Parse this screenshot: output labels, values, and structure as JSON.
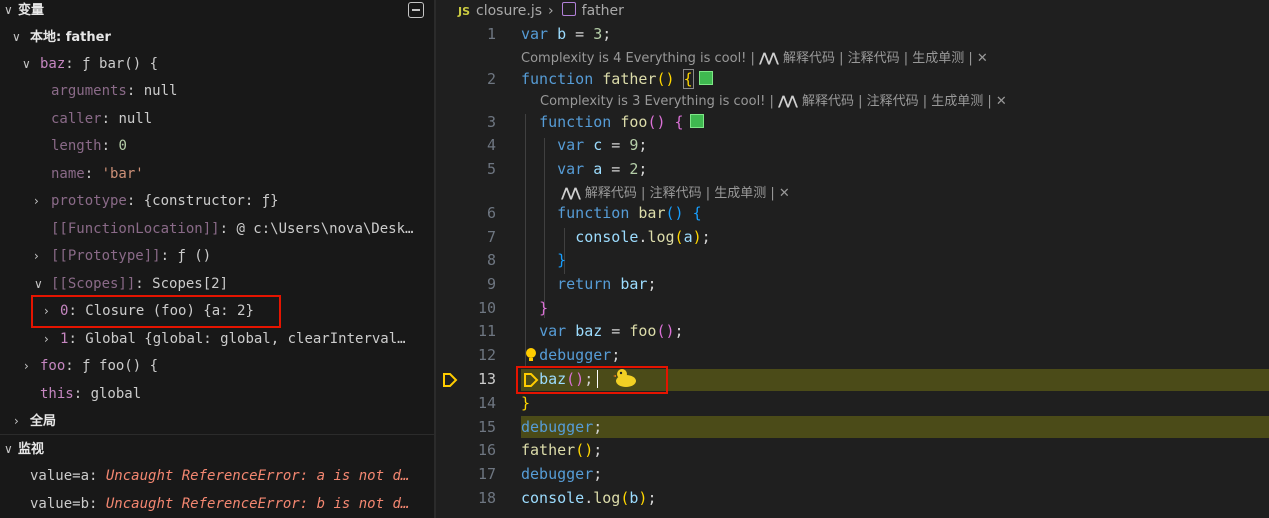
{
  "variables_panel": {
    "title": "变量",
    "local_scope": "本地: father",
    "baz": {
      "key": "baz",
      "value": "ƒ bar() {"
    },
    "arguments": {
      "key": "arguments",
      "value": "null"
    },
    "caller": {
      "key": "caller",
      "value": "null"
    },
    "length": {
      "key": "length",
      "value": "0"
    },
    "name": {
      "key": "name",
      "value": "'bar'"
    },
    "prototype": {
      "key": "prototype",
      "value": "{constructor: ƒ}"
    },
    "function_location": {
      "key": "[[FunctionLocation]]",
      "value": "@ c:\\Users\\nova\\Desk…"
    },
    "proto": {
      "key": "[[Prototype]]",
      "value": "ƒ ()"
    },
    "scopes": {
      "key": "[[Scopes]]",
      "value": "Scopes[2]"
    },
    "scope0": {
      "key": "0",
      "value": "Closure (foo) {a: 2}"
    },
    "scope1": {
      "key": "1",
      "value": "Global {global: global, clearInterval…"
    },
    "foo": {
      "key": "foo",
      "value": "ƒ foo() {"
    },
    "this": {
      "key": "this",
      "value": "global"
    },
    "global_scope": "全局"
  },
  "watch_panel": {
    "title": "监视",
    "items": [
      {
        "expr": "value=a:",
        "error": "Uncaught ReferenceError: a is not d…"
      },
      {
        "expr": "value=b:",
        "error": "Uncaught ReferenceError: b is not d…"
      }
    ]
  },
  "editor": {
    "breadcrumb_lang": "JS",
    "breadcrumb_file": "closure.js",
    "breadcrumb_symbol": "father",
    "codelens_1": "Complexity is 4 Everything is cool! | ",
    "codelens_2": "Complexity is 3 Everything is cool! | ",
    "codelens_actions": "解释代码 | 注释代码 | 生成单测 | ✕",
    "line_numbers": [
      "1",
      "2",
      "3",
      "4",
      "5",
      "6",
      "7",
      "8",
      "9",
      "10",
      "11",
      "12",
      "13",
      "14",
      "15",
      "16",
      "17",
      "18"
    ],
    "current_line": "13"
  }
}
